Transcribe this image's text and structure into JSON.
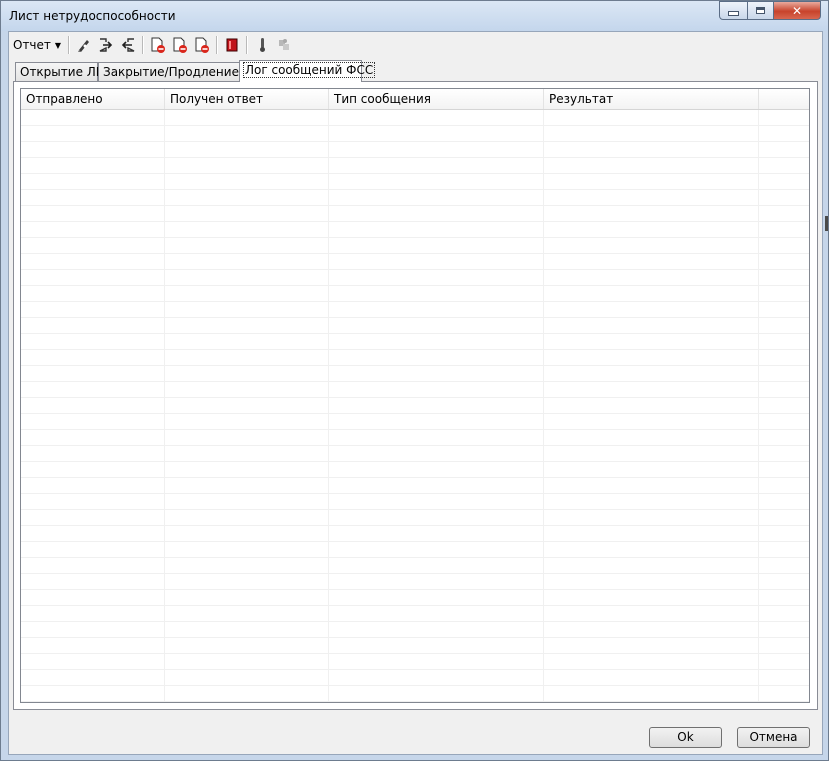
{
  "window": {
    "title": "Лист нетрудоспособности",
    "close_glyph": "✕"
  },
  "toolbar": {
    "report_menu": "Отчет",
    "buttons": [
      {
        "icon": "pen-icon"
      },
      {
        "icon": "export-arrow-icon"
      },
      {
        "icon": "import-arrow-icon"
      },
      {
        "icon": "doc-delete-icon"
      },
      {
        "icon": "doc-delete-icon"
      },
      {
        "icon": "doc-delete-icon"
      },
      {
        "icon": "red-book-icon"
      },
      {
        "icon": "thermometer-icon"
      },
      {
        "icon": "puzzle-disabled-icon"
      }
    ]
  },
  "tabs": [
    {
      "label": "Открытие ЛН"
    },
    {
      "label": "Закрытие/Продление ЛН"
    },
    {
      "label": "Лог сообщений ФСС",
      "active": true
    }
  ],
  "grid": {
    "columns": [
      "Отправлено",
      "Получен ответ",
      "Тип сообщения",
      "Результат"
    ],
    "rows": []
  },
  "footer": {
    "ok_label": "Ok",
    "cancel_label": "Отмена"
  },
  "colors": {
    "frame": "#c6d6ea",
    "close_button": "#c8432b",
    "face": "#f0f0f0"
  }
}
